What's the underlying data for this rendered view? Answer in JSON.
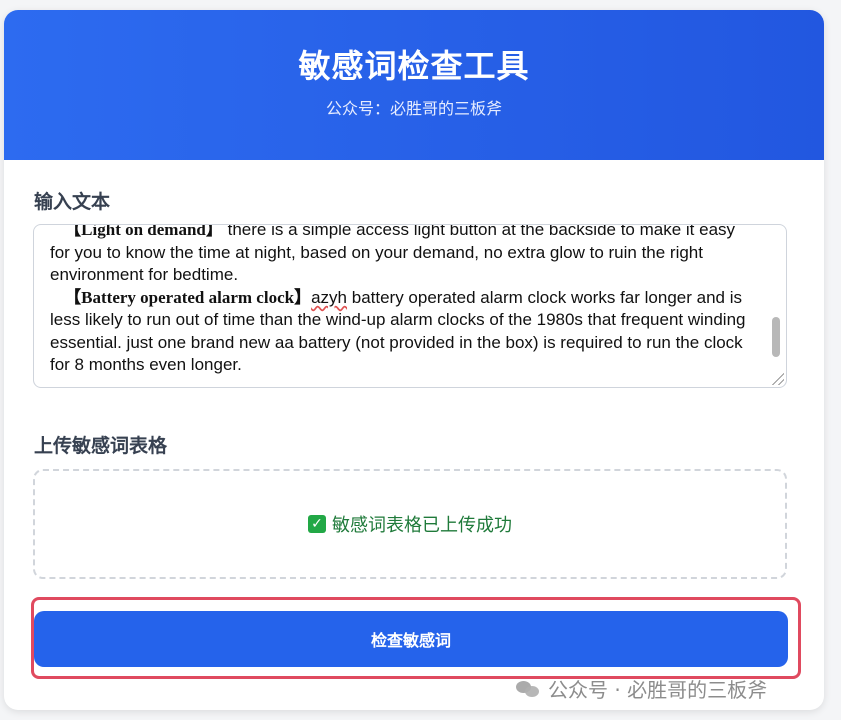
{
  "header": {
    "title": "敏感词检查工具",
    "subtitle": "公众号：必胜哥的三板斧"
  },
  "input_section": {
    "label": "输入文本",
    "text": {
      "p1_heading": "【Light on demand】",
      "p1_body": "there is a simple access light button at the backside to make it easy for you to know the time at night, based on your demand, no extra glow to ruin the right environment for bedtime.",
      "p2_heading": "【Battery operated alarm clock】",
      "p2_brand": "azyh",
      "p2_body": " battery operated alarm clock works far longer and is less likely to run out of time than the wind-up alarm clocks of the 1980s that frequent winding essential. just one brand new aa battery (not provided in the box) is required to run the clock for 8 months even longer."
    }
  },
  "upload_section": {
    "label": "上传敏感词表格",
    "status_text": "敏感词表格已上传成功",
    "status_icon": "check-mark-icon"
  },
  "actions": {
    "check_label": "检查敏感词"
  },
  "watermark": {
    "text": "公众号 · 必胜哥的三板斧",
    "icon": "wechat-icon"
  },
  "colors": {
    "header_bg": "#2563eb",
    "button_bg": "#2563eb",
    "success_text": "#1f7a3a",
    "highlight_border": "#e04a5f"
  }
}
